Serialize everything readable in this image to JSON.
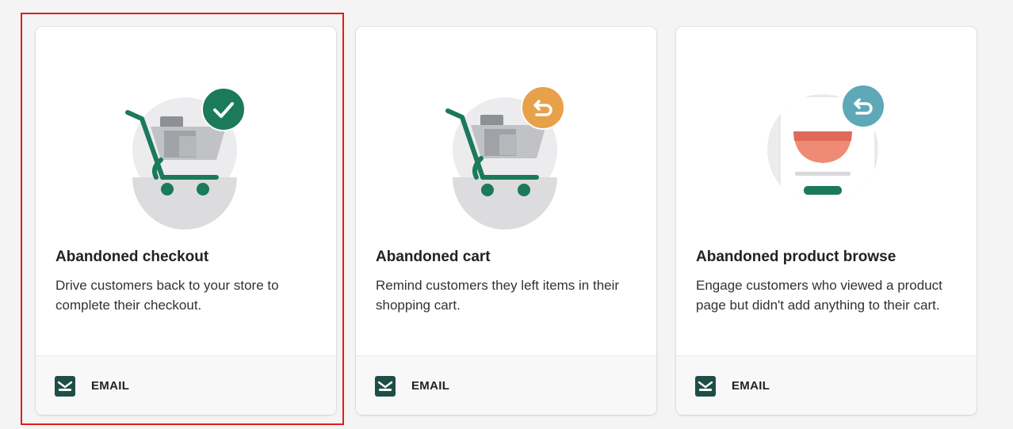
{
  "templates": [
    {
      "title": "Abandoned checkout",
      "description": "Drive customers back to your store to complete their checkout.",
      "channel": "EMAIL",
      "illustration": "cart-check-illustration",
      "badge_icon": "checkmark-icon",
      "badge_color": "#1a7a59",
      "selected": true
    },
    {
      "title": "Abandoned cart",
      "description": "Remind customers they left items in their shopping cart.",
      "channel": "EMAIL",
      "illustration": "cart-return-illustration",
      "badge_icon": "return-arrow-icon",
      "badge_color": "#e7a14b",
      "selected": false
    },
    {
      "title": "Abandoned product browse",
      "description": "Engage customers who viewed a product page but didn't add anything to their cart.",
      "channel": "EMAIL",
      "illustration": "product-page-return-illustration",
      "badge_icon": "return-arrow-icon",
      "badge_color": "#5ea8b7",
      "selected": false
    }
  ],
  "colors": {
    "brand_green": "#1a7a59",
    "selection_outline": "#e31b1b",
    "channel_icon": "#1f4e46"
  }
}
